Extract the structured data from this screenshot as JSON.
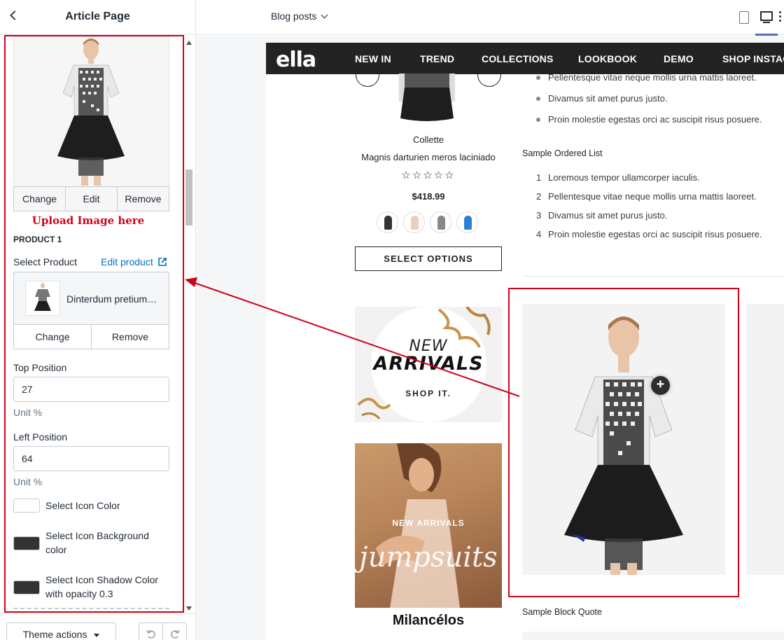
{
  "sidebar": {
    "title": "Article Page",
    "image_actions": [
      "Change",
      "Edit",
      "Remove"
    ],
    "upload_note": "Upload Image here",
    "product_heading": "PRODUCT 1",
    "select_product_label": "Select Product",
    "edit_product_link": "Edit product",
    "product_name": "Dinterdum pretium…",
    "product_actions": [
      "Change",
      "Remove"
    ],
    "top_position": {
      "label": "Top Position",
      "value": "27",
      "unit": "Unit %"
    },
    "left_position": {
      "label": "Left Position",
      "value": "64",
      "unit": "Unit %"
    },
    "icon_color": {
      "label": "Select Icon Color",
      "color": "#ffffff"
    },
    "icon_bg_color": {
      "label_line1": "Select Icon Background",
      "label_line2": "color",
      "color": "#333333"
    },
    "icon_shadow_color": {
      "label_line1": "Select Icon Shadow Color",
      "label_line2": "with opacity 0.3",
      "color": "#333333"
    },
    "footer": {
      "theme_actions": "Theme actions",
      "undo_icon": "undo-icon",
      "redo_icon": "redo-icon"
    }
  },
  "topbar": {
    "page_select": "Blog posts",
    "icons": [
      "mobile-view-icon",
      "desktop-view-icon",
      "more-icon"
    ]
  },
  "preview": {
    "logo": "ella",
    "nav": [
      "NEW IN",
      "TREND",
      "COLLECTIONS",
      "LOOKBOOK",
      "DEMO",
      "SHOP INSTAC"
    ],
    "product": {
      "brand": "Collette",
      "name": "Magnis darturien meros laciniado",
      "stars": "☆☆☆☆☆",
      "price": "$418.99",
      "select_options": "SELECT OPTIONS"
    },
    "unordered_list": [
      "Pellentesque vitae neque mollis urna mattis laoreet.",
      "Divamus sit amet purus justo.",
      "Proin molestie egestas orci ac suscipit risus posuere."
    ],
    "ordered_list_title": "Sample Ordered List",
    "ordered_list": [
      "Loremous tempor ullamcorper iaculis.",
      "Pellentesque vitae neque mollis urna mattis laoreet.",
      "Divamus sit amet purus justo.",
      "Proin molestie egestas orci ac suscipit risus posuere."
    ],
    "banner1": {
      "line1": "NEW",
      "line2": "ARRIVALS",
      "cta": "SHOP IT."
    },
    "banner2": {
      "line1": "NEW ARRIVALS",
      "script": "jumpsuits"
    },
    "brand_caption": "Milancélos",
    "hotspot_symbol": "+",
    "block_quote_title": "Sample Block Quote"
  },
  "colors": {
    "annotation_red": "#d0021b",
    "link_blue": "#006fbb",
    "nav_bg": "#232323",
    "active_tab": "#5c6ac4"
  }
}
